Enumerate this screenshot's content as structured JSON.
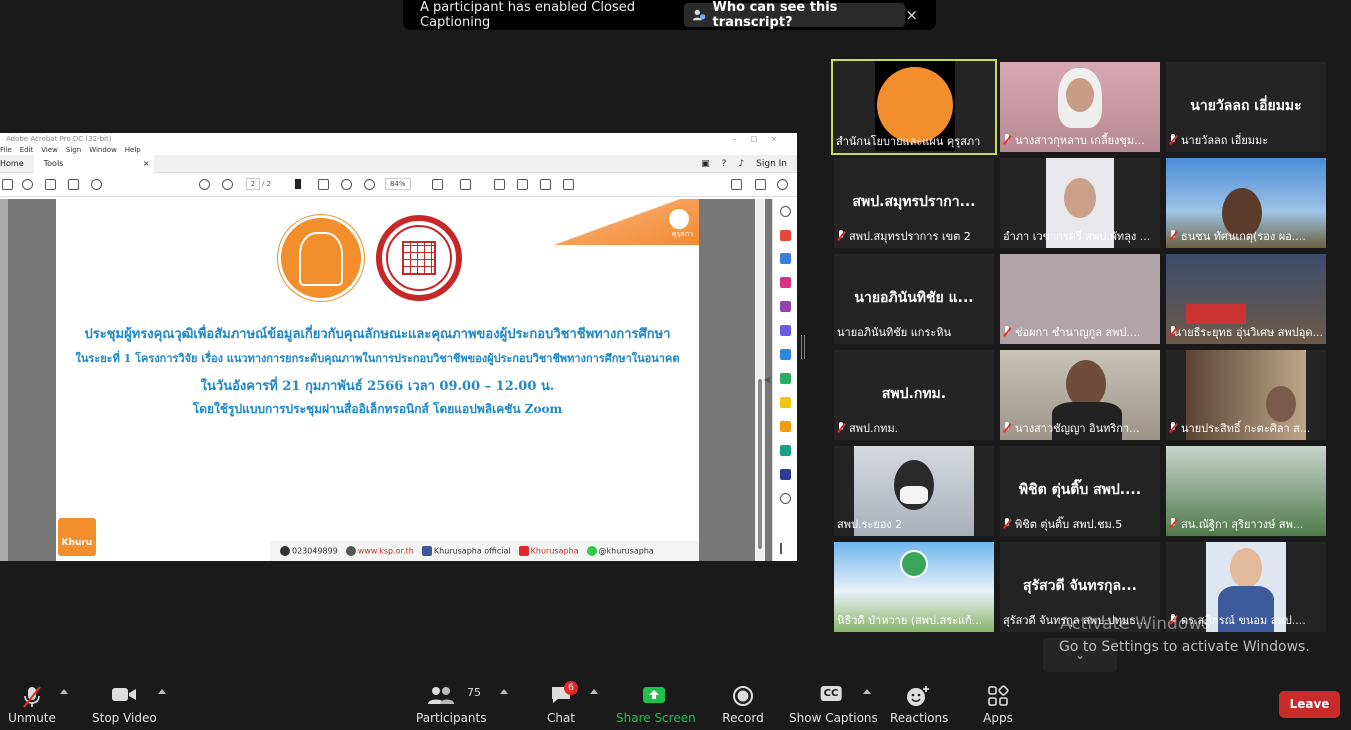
{
  "banner": {
    "message": "A participant has enabled Closed Captioning",
    "who_label": "Who can see this transcript?",
    "close_glyph": "×"
  },
  "app": {
    "title": "Adobe Acrobat Pro DC (32-bit)",
    "menu": [
      "File",
      "Edit",
      "View",
      "Sign",
      "Window",
      "Help"
    ],
    "tabs": {
      "home": "Home",
      "tools": "Tools",
      "close": "×"
    },
    "sign_in": "Sign In",
    "page_current": "2",
    "page_total": "/ 2",
    "zoom": "84%"
  },
  "document": {
    "badge_text": "คุรุสภา",
    "line1": "ประชุมผู้ทรงคุณวุฒิเพื่อสัมภาษณ์ข้อมูลเกี่ยวกับคุณลักษณะและคุณภาพของผู้ประกอบวิชาชีพทางการศึกษา",
    "line2": "ในระยะที่ 1 โครงการวิจัย เรื่อง แนวทางการยกระดับคุณภาพในการประกอบวิชาชีพของผู้ประกอบวิชาชีพทางการศึกษาในอนาคต",
    "line3": "ในวันอังคารที่ 21 กุมภาพันธ์ 2566 เวลา 09.00 – 12.00 น.",
    "line4": "โดยใช้รูปแบบการประชุมผ่านสื่ออิเล็กทรอนิกส์ โดยแอปพลิเคชัน Zoom",
    "khuru_logo": "Khuru",
    "footer": {
      "phone": "023049899",
      "web": "www.ksp.or.th",
      "facebook": "Khurusapha official",
      "youtube": "Khurusapha",
      "line": "@khurusapha"
    }
  },
  "participants": [
    {
      "big": "",
      "label": "สำนักนโยบายและแผน คุรุสภา",
      "mic": false
    },
    {
      "big": "",
      "label": "นางสาวกุหลาบ  เกลี้ยงชุม...",
      "mic": true
    },
    {
      "big": "นายวัลลถ เอี่ยมมะ",
      "label": "นายวัลลถ เอี่ยมมะ",
      "mic": true
    },
    {
      "big": "สพป.สมุทรปรากา...",
      "label": "สพป.สมุทรปราการ เขต 2",
      "mic": true
    },
    {
      "big": "",
      "label": "อำภา เวชากรศรี สพป.พัทลุง ...",
      "mic": false
    },
    {
      "big": "",
      "label": "ธนชน ทัศนเกตุ(รอง ผอ....",
      "mic": true
    },
    {
      "big": "นายอภินันทิชัย แ...",
      "label": "นายอภินันทิชัย แกระหิน",
      "mic": false
    },
    {
      "big": "",
      "label": "ช่อผกา ชำนาญกูล สพป....",
      "mic": true
    },
    {
      "big": "",
      "label": "นายธีระยุทธ อุ่นวิเศษ สพปอุด...",
      "mic": true
    },
    {
      "big": "สพป.กทม.",
      "label": "สพป.กทม.",
      "mic": true
    },
    {
      "big": "",
      "label": "นางสาวชัญญา อินทริกา...",
      "mic": true
    },
    {
      "big": "",
      "label": "นายประสิทธิ์  กะตะศิลา ส...",
      "mic": true
    },
    {
      "big": "",
      "label": "สพป.ระยอง 2",
      "mic": false
    },
    {
      "big": "พิชิต ตุ่นติ๊บ สพป....",
      "label": "พิชิต ตุ่นติ๊บ สพป.ชม.5",
      "mic": true
    },
    {
      "big": "",
      "label": "สน.ณัฐิกา  สุริยาวงษ์ สพ...",
      "mic": true
    },
    {
      "big": "",
      "label": "นิธิวดี  ป่าหวาย (สพป.สระแก้...",
      "mic": false
    },
    {
      "big": "สุรัสวดี จันทรกุล...",
      "label": "สุรัสวดี จันทรกุล สพป.ปทุมธ...",
      "mic": false
    },
    {
      "big": "",
      "label": "ดร.สุภิภรณ์ ขนอม สพป....",
      "mic": true
    }
  ],
  "watermark": {
    "line1": "Activate Windows",
    "line2": "Go to Settings to activate Windows."
  },
  "toolbar": {
    "unmute": "Unmute",
    "stop_video": "Stop Video",
    "participants": "Participants",
    "participant_count": "75",
    "chat": "Chat",
    "chat_badge": "6",
    "share_screen": "Share Screen",
    "record": "Record",
    "show_captions": "Show Captions",
    "cc_glyph": "CC",
    "reactions": "Reactions",
    "apps": "Apps",
    "leave": "Leave"
  },
  "colors": {
    "active_speaker": "#c9dc52",
    "share_green": "#1fc14b",
    "leave_red": "#c92a2a",
    "doc_blue": "#1e88c8",
    "ksp_orange": "#f28e2b"
  }
}
